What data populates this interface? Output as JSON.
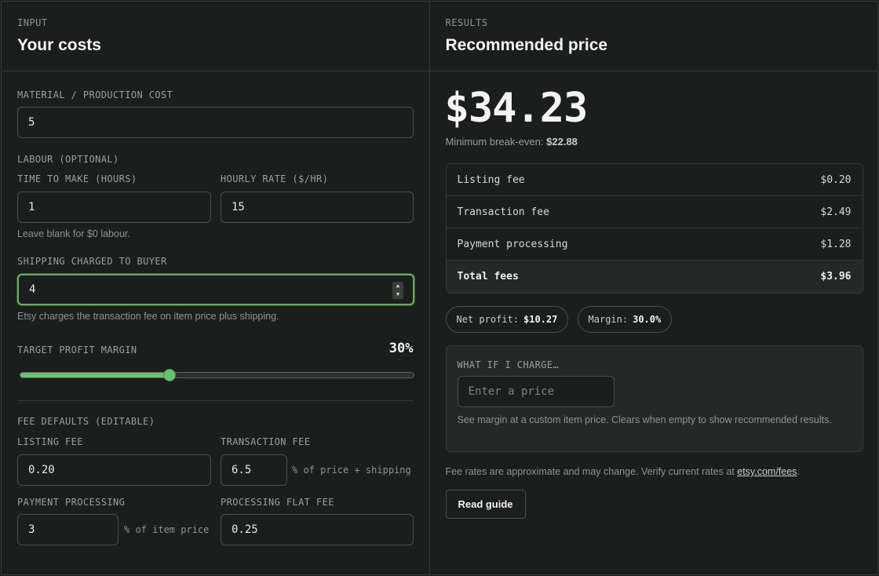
{
  "input_panel": {
    "eyebrow": "INPUT",
    "title": "Your costs",
    "material": {
      "label": "MATERIAL / PRODUCTION COST",
      "value": "5"
    },
    "labour": {
      "section_label": "LABOUR (OPTIONAL)",
      "time_label": "TIME TO MAKE (HOURS)",
      "time_value": "1",
      "rate_label": "HOURLY RATE ($/HR)",
      "rate_value": "15",
      "hint": "Leave blank for $0 labour."
    },
    "shipping": {
      "label": "SHIPPING CHARGED TO BUYER",
      "value": "4",
      "hint": "Etsy charges the transaction fee on item price plus shipping."
    },
    "margin": {
      "label": "TARGET PROFIT MARGIN",
      "value_text": "30%",
      "percent": 38
    },
    "fee_defaults": {
      "section_label": "FEE DEFAULTS (EDITABLE)",
      "listing_label": "LISTING FEE",
      "listing_value": "0.20",
      "transaction_label": "TRANSACTION FEE",
      "transaction_value": "6.5",
      "transaction_unit": "% of price + shipping",
      "processing_label": "PAYMENT PROCESSING",
      "processing_value": "3",
      "processing_unit": "% of item price",
      "flat_label": "PROCESSING FLAT FEE",
      "flat_value": "0.25"
    }
  },
  "results_panel": {
    "eyebrow": "RESULTS",
    "title": "Recommended price",
    "price": "$34.23",
    "breakeven_label": "Minimum break-even:",
    "breakeven_value": "$22.88",
    "fees": [
      {
        "label": "Listing fee",
        "value": "$0.20"
      },
      {
        "label": "Transaction fee",
        "value": "$2.49"
      },
      {
        "label": "Payment processing",
        "value": "$1.28"
      }
    ],
    "total_label": "Total fees",
    "total_value": "$3.96",
    "net_profit_label": "Net profit:",
    "net_profit_value": "$10.27",
    "margin_label": "Margin:",
    "margin_value": "30.0%",
    "whatif": {
      "label": "WHAT IF I CHARGE…",
      "placeholder": "Enter a price",
      "hint": "See margin at a custom item price. Clears when empty to show recommended results."
    },
    "disclaimer_text": "Fee rates are approximate and may change. Verify current rates at",
    "disclaimer_link": "etsy.com/fees",
    "disclaimer_end": ".",
    "guide_button": "Read guide"
  },
  "colors": {
    "accent": "#6fbf73",
    "focus_border": "#6ea766",
    "background": "#1b1e1c"
  },
  "icons": {
    "stepper": "up-down-stepper-icon"
  }
}
